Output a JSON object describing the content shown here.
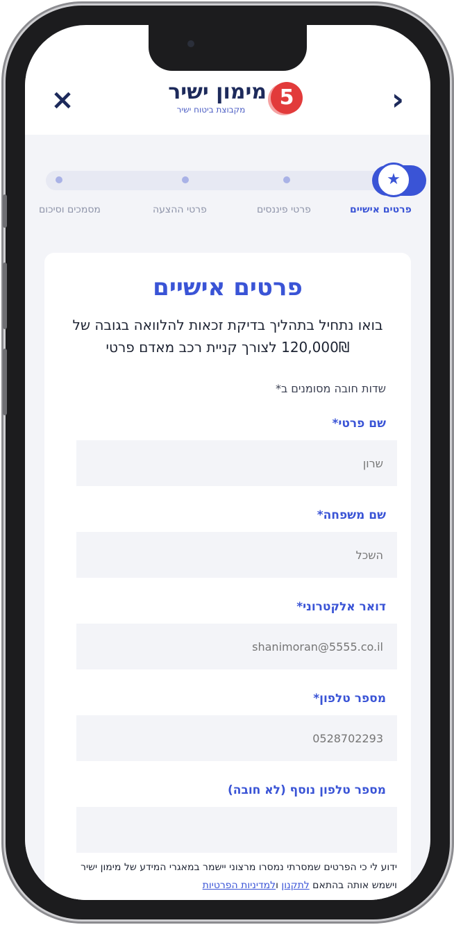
{
  "header": {
    "brand_name": "מימון ישיר",
    "brand_subtitle": "מקבוצת ביטוח ישיר",
    "badge_number": "5",
    "close_icon": "×",
    "back_icon": "›"
  },
  "steps": [
    {
      "label": "פרטים אישיים",
      "active": true
    },
    {
      "label": "פרטי פיננסים",
      "active": false
    },
    {
      "label": "פרטי ההצעה",
      "active": false
    },
    {
      "label": "מסמכים וסיכום",
      "active": false
    }
  ],
  "form": {
    "title": "פרטים אישיים",
    "intro": "בואו נתחיל בתהליך בדיקת זכאות להלוואה בגובה של 120,000₪ לצורך קניית רכב מאדם פרטי",
    "required_note": "שדות חובה מסומנים ב*",
    "fields": [
      {
        "label": "שם פרטי*",
        "value": ""
      },
      {
        "label": "שם משפחה*",
        "value": ""
      },
      {
        "label": "דואר אלקטרוני*",
        "value": ""
      },
      {
        "label": "מספר טלפון*",
        "value": ""
      },
      {
        "label": "מספר טלפון נוסף (לא חובה)",
        "value": ""
      }
    ],
    "placeholders": [
      "שרון",
      "השכל",
      "shanimoran@5555.co.il",
      "0528702293",
      ""
    ]
  },
  "disclaimer": {
    "text": "ידוע לי כי הפרטים שמסרתי נמסרו מרצוני יישמר במאגרי המידע של מימון ישיר וישמש אותה בהתאם ",
    "terms_link": "לתקנון",
    "joiner": " ו",
    "privacy_link": "למדיניות הפרטיות"
  },
  "colors": {
    "accent": "#3a54d6",
    "navy": "#1d2a5b",
    "badge": "#e23b3b",
    "background": "#f3f4f8"
  },
  "icons": {
    "active_step": "star-icon"
  }
}
